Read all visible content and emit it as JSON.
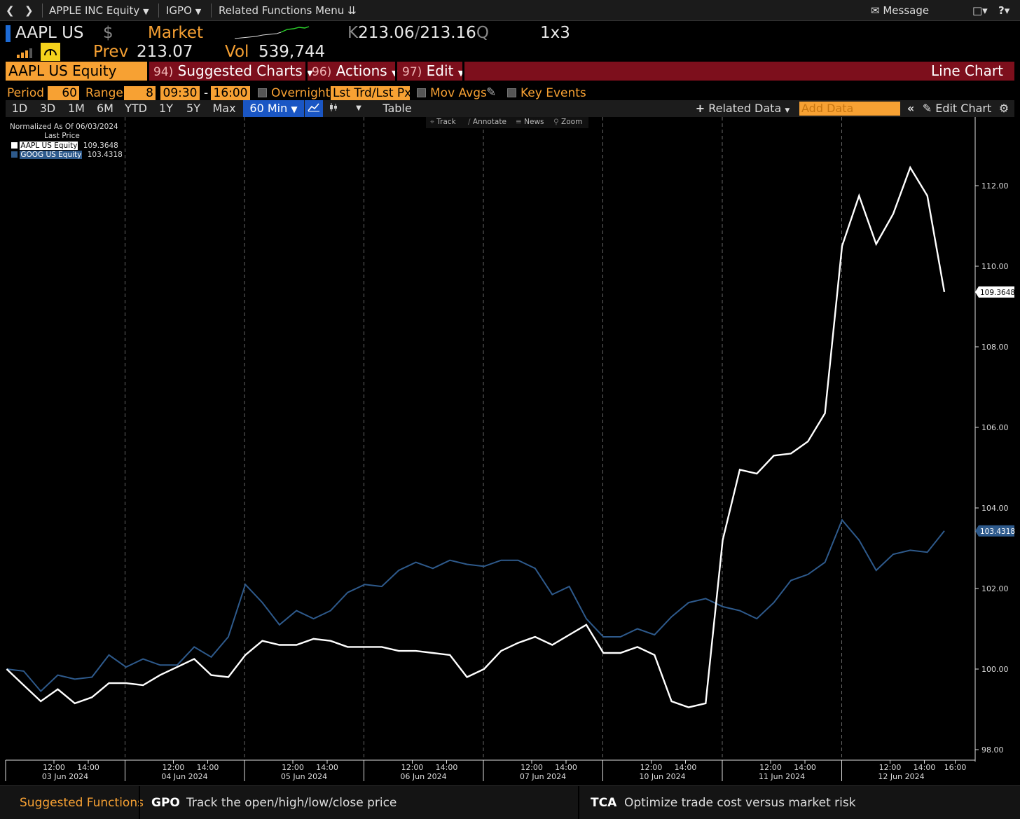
{
  "nav": {
    "security_menu": "APPLE INC Equity",
    "function_menu": "IGPO",
    "related_menu": "Related Functions Menu",
    "message": "Message"
  },
  "header": {
    "ticker": "AAPL US",
    "currency": "$",
    "market_label": "Market",
    "bid_prefix": "K",
    "bid": "213.06",
    "ask": "213.16",
    "ask_suffix": "Q",
    "size": "1x3",
    "prev_label": "Prev",
    "prev_value": "213.07",
    "vol_label": "Vol",
    "vol_value": "539,744"
  },
  "menubar": {
    "security": "AAPL US Equity",
    "suggested_num": "94)",
    "suggested_label": "Suggested Charts",
    "actions_num": "96)",
    "actions_label": "Actions",
    "edit_num": "97)",
    "edit_label": "Edit",
    "chart_type": "Line Chart"
  },
  "settings": {
    "period_label": "Period",
    "period_value": "60",
    "range_label": "Range",
    "range_value": "8",
    "start_time": "09:30",
    "dash": "-",
    "end_time": "16:00",
    "overnight_label": "Overnight",
    "price_field": "Lst Trd/Lst Px",
    "mov_avgs_label": "Mov Avgs",
    "key_events_label": "Key Events"
  },
  "toolbar": {
    "ranges": [
      "1D",
      "3D",
      "1M",
      "6M",
      "YTD",
      "1Y",
      "5Y",
      "Max"
    ],
    "interval": "60 Min",
    "table": "Table",
    "related_data": "Related Data",
    "add_data_placeholder": "Add Data",
    "edit_chart": "Edit Chart"
  },
  "chart_tools": [
    "Track",
    "Annotate",
    "News",
    "Zoom"
  ],
  "legend": {
    "title": "Normalized As Of 06/03/2024",
    "subtitle": "Last Price",
    "items": [
      {
        "name": "AAPL US Equity",
        "value": "109.3648",
        "color": "#ffffff"
      },
      {
        "name": "GOOG US Equity",
        "value": "103.4318",
        "color": "#2e5a8c"
      }
    ]
  },
  "chart_data": {
    "type": "line",
    "ylim": [
      97.8,
      113.0
    ],
    "yticks": [
      "98.00",
      "100.00",
      "102.00",
      "104.00",
      "106.00",
      "108.00",
      "110.00",
      "112.00"
    ],
    "grid": "vertical dashed day separators",
    "last_labels": {
      "AAPL US Equity": "109.3648",
      "GOOG US Equity": "103.4318"
    },
    "days": [
      {
        "date": "03 Jun 2024",
        "ticks": [
          "12:00",
          "14:00"
        ]
      },
      {
        "date": "04 Jun 2024",
        "ticks": [
          "12:00",
          "14:00"
        ]
      },
      {
        "date": "05 Jun 2024",
        "ticks": [
          "12:00",
          "14:00"
        ]
      },
      {
        "date": "06 Jun 2024",
        "ticks": [
          "12:00",
          "14:00"
        ]
      },
      {
        "date": "07 Jun 2024",
        "ticks": [
          "12:00",
          "14:00"
        ]
      },
      {
        "date": "10 Jun 2024",
        "ticks": [
          "12:00",
          "14:00"
        ]
      },
      {
        "date": "11 Jun 2024",
        "ticks": [
          "12:00",
          "14:00"
        ]
      },
      {
        "date": "12 Jun 2024",
        "ticks": [
          "12:00",
          "14:00",
          "16:00"
        ]
      }
    ],
    "series": [
      {
        "name": "AAPL US Equity",
        "color": "#ffffff",
        "values": [
          100.0,
          99.6,
          99.2,
          99.5,
          99.15,
          99.3,
          99.65,
          99.65,
          99.6,
          99.85,
          100.05,
          100.25,
          99.85,
          99.8,
          100.35,
          100.7,
          100.6,
          100.6,
          100.75,
          100.7,
          100.55,
          100.55,
          100.55,
          100.45,
          100.45,
          100.4,
          100.35,
          99.8,
          100.0,
          100.45,
          100.65,
          100.8,
          100.6,
          100.85,
          101.1,
          100.4,
          100.4,
          100.55,
          100.35,
          99.2,
          99.05,
          99.15,
          103.2,
          104.95,
          104.85,
          105.3,
          105.35,
          105.65,
          106.35,
          110.5,
          111.75,
          110.55,
          111.3,
          112.45,
          111.75,
          109.36
        ]
      },
      {
        "name": "GOOG US Equity",
        "color": "#2e5a8c",
        "values": [
          100.0,
          99.95,
          99.45,
          99.85,
          99.75,
          99.8,
          100.35,
          100.05,
          100.25,
          100.1,
          100.1,
          100.55,
          100.3,
          100.8,
          102.1,
          101.65,
          101.1,
          101.45,
          101.25,
          101.45,
          101.9,
          102.1,
          102.05,
          102.45,
          102.65,
          102.5,
          102.7,
          102.6,
          102.55,
          102.7,
          102.7,
          102.5,
          101.85,
          102.05,
          101.25,
          100.8,
          100.8,
          101.0,
          100.85,
          101.3,
          101.65,
          101.75,
          101.55,
          101.45,
          101.25,
          101.65,
          102.2,
          102.35,
          102.65,
          103.7,
          103.2,
          102.45,
          102.85,
          102.95,
          102.9,
          103.43
        ]
      }
    ]
  },
  "bottom": {
    "suggested_label": "Suggested Functions",
    "fn1_code": "GPO",
    "fn1_desc": "Track the open/high/low/close price",
    "fn2_code": "TCA",
    "fn2_desc": "Optimize trade cost versus market risk"
  }
}
